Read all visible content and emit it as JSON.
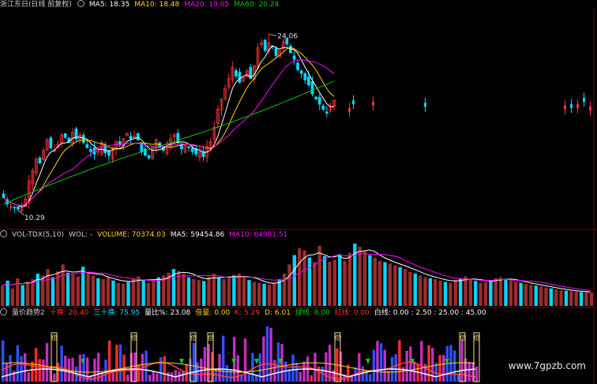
{
  "colors": {
    "up": "#ff3232",
    "down": "#00d7ff",
    "ma5": "#ffffff",
    "ma10": "#ffd700",
    "ma20": "#ff00ff",
    "ma60": "#00c800",
    "volbar_up": "#9d2c2c",
    "panel_line": "#7a0000"
  },
  "price_panel": {
    "title": "浙江东日(日线 前复权)",
    "ma5": "MA5: 18.35",
    "ma10": "MA10: 18.48",
    "ma20": "MA20: 19.05",
    "ma60": "MA60: 20.24",
    "high_label": "24.06",
    "low_label": "10.29"
  },
  "volume_panel": {
    "name": "VOL-TDX(5,10)",
    "wol": "WOL: -",
    "volume": "VOLUME: 70374.03",
    "ma5": "MA5: 59454.86",
    "ma10": "MA10: 64981.51"
  },
  "trend_panel": {
    "name": "量价趋势2",
    "shi_huan": "十换: 20.40",
    "san_shi_huan": "三十换: 75.95",
    "liang_bi": "量比%: 23.08",
    "bei_liang": "倍量: 0.00",
    "k": "K: 5.29",
    "d": "D: 6.01",
    "lv_xian": "绿线: 0.00",
    "hong_xian": "红线: 0.00",
    "bai_xian": "白线: 0.00 : 2.50 : 25.00 : 45.00",
    "marker_text": "倍"
  },
  "watermark": "www.7gpzb.com",
  "chart_data": {
    "type": "candlestick",
    "title": "浙江东日(日线 前复权)",
    "price_range": [
      9.0,
      26.0
    ],
    "high": 24.06,
    "low": 10.29,
    "closes": [
      11.3,
      10.8,
      10.6,
      10.5,
      10.4,
      10.6,
      11.2,
      12.6,
      13.4,
      14.3,
      14.0,
      15.0,
      15.8,
      15.2,
      15.0,
      15.5,
      16.2,
      16.0,
      15.6,
      16.4,
      15.9,
      16.2,
      15.6,
      15.2,
      14.9,
      14.7,
      15.0,
      15.6,
      14.8,
      14.6,
      15.1,
      15.7,
      15.4,
      15.9,
      16.3,
      15.9,
      16.1,
      15.8,
      14.9,
      14.6,
      14.4,
      15.3,
      15.8,
      15.2,
      15.0,
      15.5,
      15.9,
      16.2,
      15.6,
      15.1,
      15.4,
      15.2,
      14.9,
      14.7,
      14.9,
      14.5,
      15.3,
      15.7,
      16.8,
      18.2,
      19.0,
      19.8,
      20.6,
      21.5,
      20.8,
      20.3,
      20.7,
      21.2,
      20.6,
      21.6,
      23.0,
      23.4,
      22.8,
      23.4,
      23.1,
      22.4,
      22.8,
      23.5,
      23.3,
      22.6,
      22.1,
      21.3,
      21.0,
      20.5,
      20.1,
      19.4,
      19.0,
      18.6,
      18.2,
      17.9,
      18.4,
      18.9
    ],
    "trading_gap_closes": [
      18.3,
      18.6,
      18.8,
      18.4,
      18.5
    ],
    "series": [
      {
        "name": "MA5",
        "last": 18.35
      },
      {
        "name": "MA10",
        "last": 18.48
      },
      {
        "name": "MA20",
        "last": 19.05
      },
      {
        "name": "MA60",
        "last": 20.24
      }
    ],
    "volume": {
      "last": 70374.03,
      "ma5": 59454.86,
      "ma10": 64981.51,
      "values": [
        42,
        55,
        38,
        60,
        45,
        52,
        58,
        70,
        65,
        80,
        62,
        75,
        90,
        72,
        68,
        64,
        85,
        70,
        66,
        60,
        58,
        62,
        55,
        50,
        48,
        52,
        60,
        64,
        56,
        50,
        54,
        62,
        66,
        72,
        80,
        76,
        70,
        62,
        58,
        56,
        54,
        64,
        70,
        62,
        58,
        60,
        66,
        70,
        64,
        56,
        52,
        50,
        48,
        46,
        50,
        58,
        70,
        90,
        110,
        125,
        120,
        105,
        95,
        130,
        108,
        96,
        100,
        112,
        98,
        115,
        135,
        128,
        118,
        110,
        104,
        98,
        95,
        92,
        88,
        84,
        80,
        74,
        70,
        66,
        62,
        60,
        58,
        55,
        52,
        50,
        56,
        60,
        64,
        58,
        54,
        50,
        52,
        56,
        60,
        62,
        58,
        55,
        52,
        50,
        48,
        46,
        44,
        42,
        40,
        38,
        36,
        34,
        33,
        32,
        31,
        30,
        30,
        29
      ]
    }
  }
}
